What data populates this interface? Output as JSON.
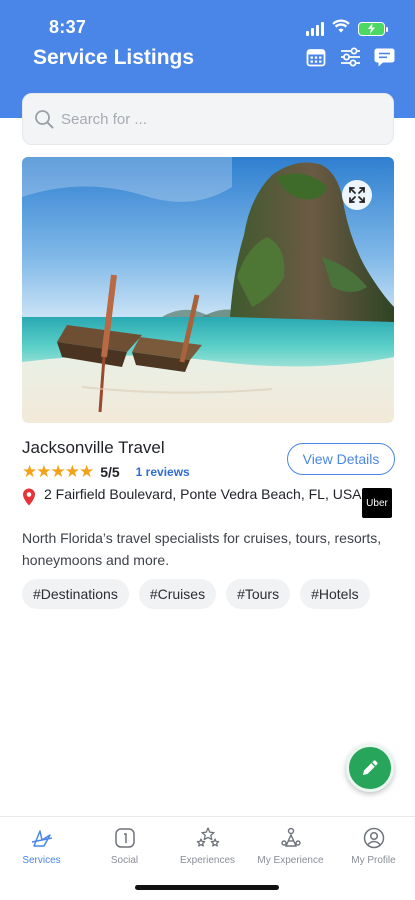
{
  "status_bar": {
    "time": "8:37"
  },
  "header": {
    "title": "Service Listings",
    "icons": [
      "calendar-icon",
      "filter-sliders-icon",
      "chat-icon"
    ],
    "color": "#4a86e8"
  },
  "search": {
    "placeholder": "Search for ..."
  },
  "listing": {
    "title": "Jacksonville Travel",
    "rating": 5,
    "rating_label": "5/5",
    "reviews_label": "1 reviews",
    "view_details_label": "View Details",
    "address": "2 Fairfield Boulevard, Ponte Vedra Beach, FL, USA",
    "ride_partner": "Uber",
    "description": "North Florida’s travel specialists for cruises, tours, resorts, honeymoons and more.",
    "tags": [
      "#Destinations",
      "#Cruises",
      "#Tours",
      "#Hotels"
    ]
  },
  "tabbar": {
    "items": [
      {
        "label": "Services",
        "icon": "services-icon",
        "active": true
      },
      {
        "label": "Social",
        "icon": "social-icon",
        "active": false
      },
      {
        "label": "Experiences",
        "icon": "experiences-icon",
        "active": false
      },
      {
        "label": "My Experience",
        "icon": "my-experience-icon",
        "active": false
      },
      {
        "label": "My Profile",
        "icon": "profile-icon",
        "active": false
      }
    ]
  },
  "colors": {
    "accent": "#4a86e8",
    "fab": "#26a55b",
    "star": "#f4a21b",
    "pin": "#e5343a"
  }
}
